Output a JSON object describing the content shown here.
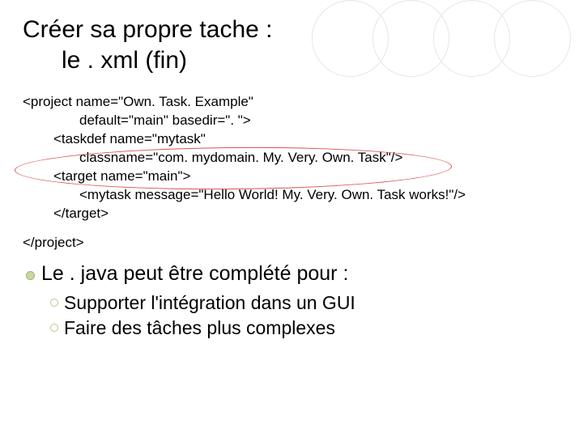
{
  "title": {
    "line1": "Créer sa propre tache :",
    "line2": "le . xml (fin)"
  },
  "code": {
    "l1": "<project name=\"Own. Task. Example\"",
    "l2": "default=\"main\" basedir=\". \">",
    "l3": "<taskdef name=\"mytask\"",
    "l4": "classname=\"com. mydomain. My. Very. Own. Task\"/>",
    "l5": "<target name=\"main\">",
    "l6": "<mytask message=\"Hello World! My. Very. Own. Task works!\"/>",
    "l7": "</target>",
    "close": "</project>"
  },
  "bullets": {
    "main": "Le . java peut être complété pour :",
    "sub1": "Supporter l'intégration dans un GUI",
    "sub2": "Faire des tâches plus complexes"
  }
}
